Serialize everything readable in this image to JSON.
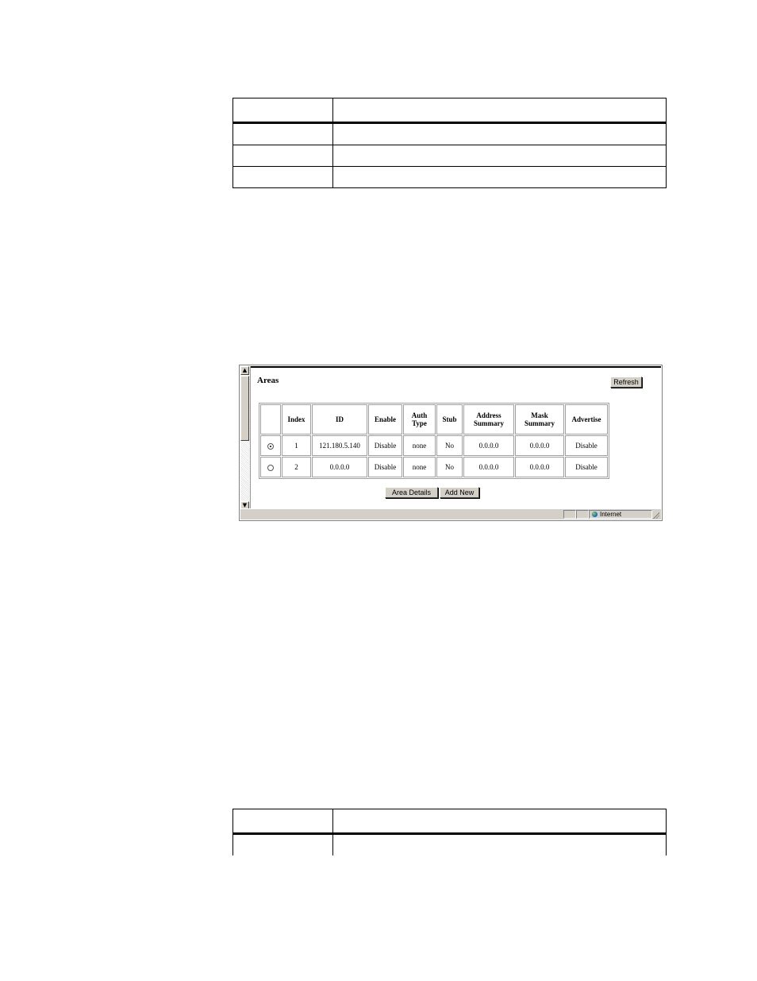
{
  "areas_panel": {
    "title": "Areas",
    "refresh_label": "Refresh",
    "columns": [
      "",
      "Index",
      "ID",
      "Enable",
      "Auth Type",
      "Stub",
      "Address Summary",
      "Mask Summary",
      "Advertise"
    ],
    "rows": [
      {
        "selected": true,
        "index": "1",
        "id": "121.180.5.140",
        "enable": "Disable",
        "auth_type": "none",
        "stub": "No",
        "address_summary": "0.0.0.0",
        "mask_summary": "0.0.0.0",
        "advertise": "Disable"
      },
      {
        "selected": false,
        "index": "2",
        "id": "0.0.0.0",
        "enable": "Disable",
        "auth_type": "none",
        "stub": "No",
        "address_summary": "0.0.0.0",
        "mask_summary": "0.0.0.0",
        "advertise": "Disable"
      }
    ],
    "area_details_label": "Area Details",
    "add_new_label": "Add New"
  },
  "status_bar": {
    "zone_label": "Internet"
  },
  "icons": {
    "scroll_up": "scroll-up-arrow-icon",
    "scroll_down": "scroll-down-arrow-icon",
    "internet_zone": "globe-icon",
    "resize": "resize-grip-icon"
  }
}
